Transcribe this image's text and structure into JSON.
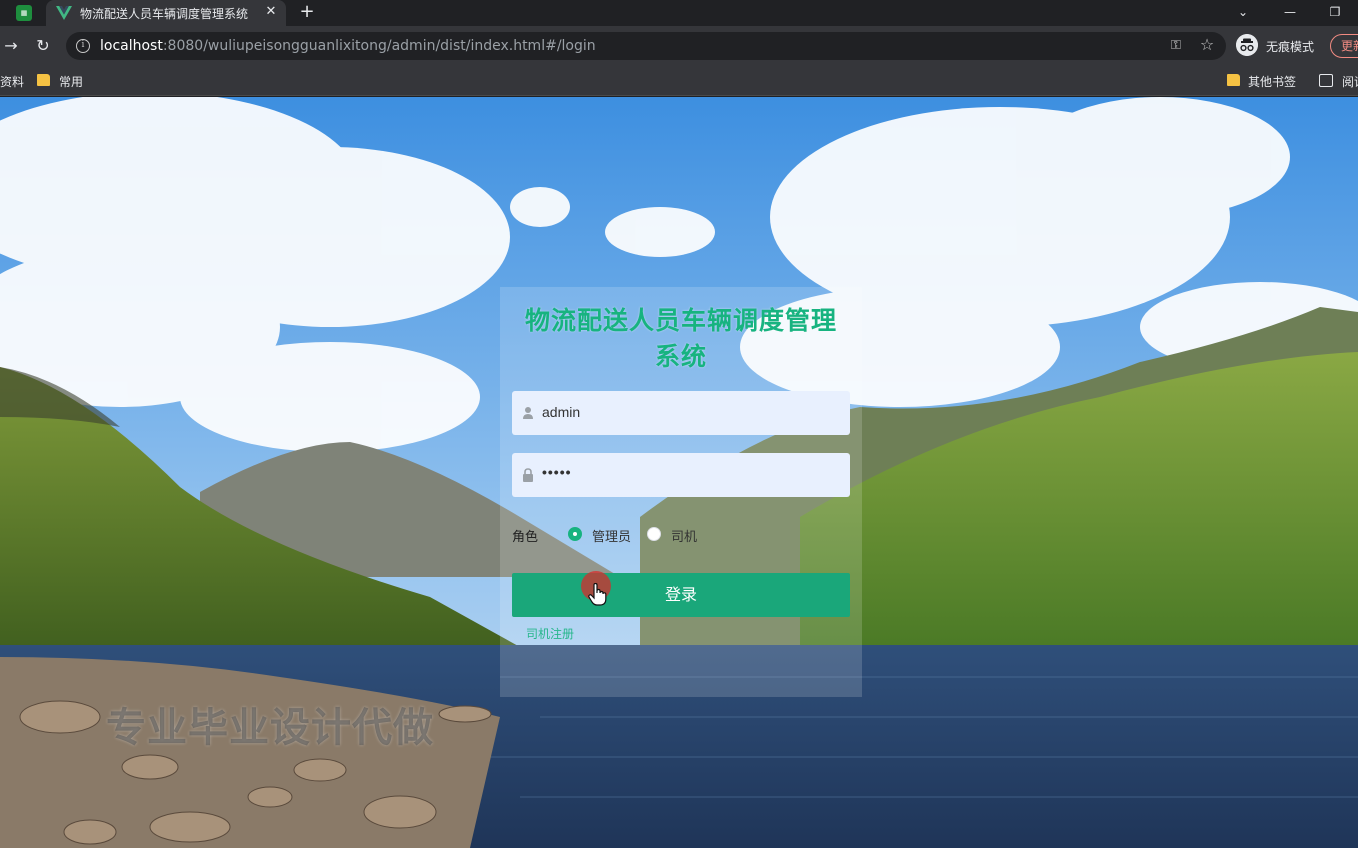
{
  "browser": {
    "tab_title": "物流配送人员车辆调度管理系统",
    "url_host": "localhost",
    "url_rest": ":8080/wuliupeisongguanlixitong/admin/dist/index.html#/login",
    "incognito_label": "无痕模式",
    "update_label": "更新",
    "bookmarks": {
      "left_partial": "资料",
      "common": "常用",
      "other": "其他书签",
      "reading_partial": "阅读"
    }
  },
  "login": {
    "title": "物流配送人员车辆调度管理系统",
    "username_value": "admin",
    "password_value": "•••••",
    "role_label": "角色",
    "role_options": [
      "管理员",
      "司机"
    ],
    "role_selected": "管理员",
    "login_button": "登录",
    "register_link": "司机注册"
  },
  "watermark": "专业毕业设计代做",
  "colors": {
    "accent": "#17b380",
    "button": "#1aa77a",
    "field_bg": "#e8f0fe"
  }
}
